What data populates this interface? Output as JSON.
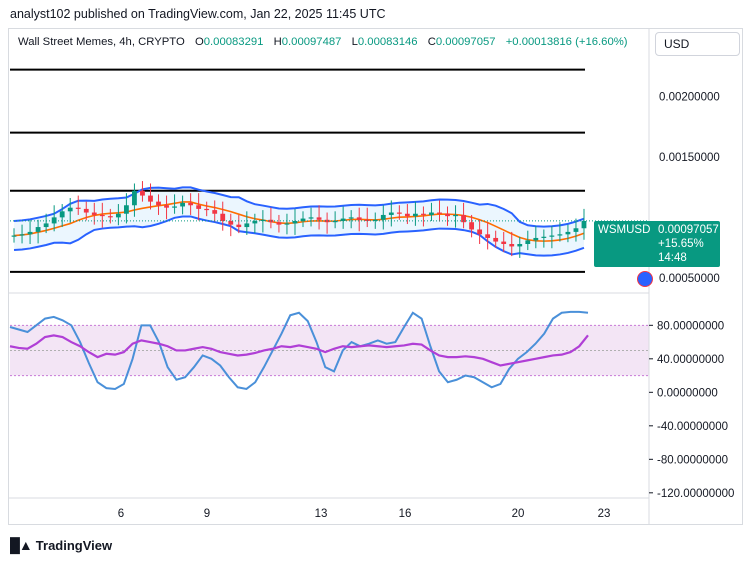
{
  "header": {
    "attribution": "analyst102 published on TradingView.com, Jan 22, 2025 11:45 UTC"
  },
  "legend": {
    "symbol": "Wall Street Memes, 4h, CRYPTO",
    "open_label": "O",
    "open": "0.00083291",
    "high_label": "H",
    "high": "0.00097487",
    "low_label": "L",
    "low": "0.00083146",
    "close_label": "C",
    "close": "0.00097057",
    "change": "+0.00013816 (+16.60%)"
  },
  "currency_button": "USD",
  "price_tag": {
    "symbol": "WSMUSD",
    "value": "0.00097057",
    "change": "+15.65%",
    "countdown": "14:48"
  },
  "footer": {
    "brand": "TradingView"
  },
  "colors": {
    "up": "#089981",
    "down": "#f23645",
    "bollinger": "#2962ff",
    "bollinger_basis": "#ff6d00",
    "bollinger_fill": "#e3f2fd",
    "stoch_k": "#4a90d9",
    "stoch_d": "#b03fd6",
    "stoch_band": "#f3e5f5"
  },
  "chart_data": [
    {
      "type": "candlestick",
      "title": "Wall Street Memes, 4h, CRYPTO",
      "x_ticks": [
        "6",
        "9",
        "13",
        "16",
        "20",
        "23"
      ],
      "y_ticks": [
        "0.00200000",
        "0.00150000",
        "0.00050000"
      ],
      "ylim": [
        0.0004,
        0.0023
      ],
      "horizontal_lines": [
        0.00222,
        0.0017,
        0.00122,
        0.00055
      ],
      "close_series": [
        0.00085,
        0.00086,
        0.00088,
        0.00092,
        0.00095,
        0.001,
        0.00105,
        0.00108,
        0.00107,
        0.00104,
        0.00102,
        0.00101,
        0.001,
        0.00103,
        0.0011,
        0.00122,
        0.00118,
        0.00113,
        0.0011,
        0.00108,
        0.00109,
        0.00112,
        0.0011,
        0.00107,
        0.00106,
        0.00103,
        0.00097,
        0.00094,
        0.00092,
        0.00095,
        0.00097,
        0.00098,
        0.00096,
        0.00094,
        0.00095,
        0.00097,
        0.00099,
        0.001,
        0.00098,
        0.00096,
        0.00097,
        0.00099,
        0.001,
        0.00098,
        0.00097,
        0.00098,
        0.00102,
        0.00104,
        0.00103,
        0.00101,
        0.00103,
        0.00102,
        0.00104,
        0.00103,
        0.00101,
        0.00102,
        0.00096,
        0.0009,
        0.00086,
        0.00083,
        0.0008,
        0.00078,
        0.00076,
        0.00078,
        0.00081,
        0.00083,
        0.00084,
        0.00085,
        0.00086,
        0.00088,
        0.00091,
        0.00097
      ],
      "last_price": 0.00097057
    },
    {
      "type": "line",
      "title": "",
      "y_ticks": [
        "80.00000000",
        "40.00000000",
        "0.00000000",
        "-40.00000000",
        "-80.00000000",
        "-120.00000000"
      ],
      "ylim": [
        -125,
        115
      ],
      "band": [
        20,
        80
      ],
      "series": [
        {
          "values": [
            78,
            75,
            72,
            80,
            88,
            90,
            86,
            80,
            60,
            35,
            12,
            5,
            4,
            10,
            40,
            80,
            80,
            60,
            30,
            15,
            18,
            30,
            44,
            40,
            32,
            18,
            6,
            4,
            12,
            30,
            50,
            70,
            92,
            95,
            85,
            60,
            30,
            25,
            50,
            60,
            55,
            58,
            62,
            58,
            60,
            78,
            95,
            88,
            55,
            25,
            12,
            15,
            20,
            18,
            12,
            6,
            10,
            28,
            40,
            48,
            58,
            70,
            88,
            95,
            96,
            96,
            95
          ]
        },
        {
          "values": [
            55,
            53,
            52,
            58,
            66,
            68,
            66,
            60,
            55,
            48,
            42,
            46,
            45,
            48,
            58,
            62,
            60,
            58,
            55,
            50,
            50,
            52,
            54,
            52,
            48,
            46,
            44,
            45,
            47,
            50,
            52,
            55,
            54,
            56,
            54,
            52,
            48,
            52,
            55,
            54,
            55,
            56,
            55,
            54,
            55,
            56,
            58,
            57,
            50,
            44,
            42,
            42,
            43,
            42,
            40,
            36,
            32,
            34,
            36,
            38,
            40,
            42,
            44,
            45,
            48,
            55,
            68
          ]
        }
      ]
    }
  ]
}
